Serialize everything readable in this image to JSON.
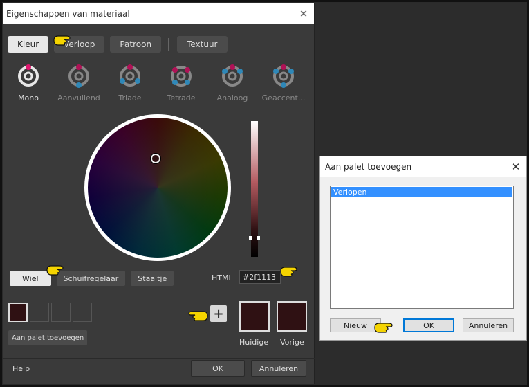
{
  "main_dialog": {
    "title": "Eigenschappen van materiaal",
    "tabs": [
      {
        "label": "Kleur",
        "active": true
      },
      {
        "label": "Verloop",
        "active": false
      },
      {
        "label": "Patroon",
        "active": false
      },
      {
        "label": "Textuur",
        "active": false
      }
    ],
    "schemes": [
      {
        "label": "Mono",
        "active": true
      },
      {
        "label": "Aanvullend",
        "active": false
      },
      {
        "label": "Triade",
        "active": false
      },
      {
        "label": "Tetrade",
        "active": false
      },
      {
        "label": "Analoog",
        "active": false
      },
      {
        "label": "Geaccent...",
        "active": false
      }
    ],
    "view_buttons": [
      {
        "label": "Wiel",
        "active": true
      },
      {
        "label": "Schuifregelaar",
        "active": false
      },
      {
        "label": "Staaltje",
        "active": false
      }
    ],
    "html_label": "HTML",
    "html_value": "#2f1113",
    "add_palette_label": "Aan palet toevoegen",
    "current_label": "Huidige",
    "previous_label": "Vorige",
    "help_label": "Help",
    "ok_label": "OK",
    "cancel_label": "Annuleren",
    "current_color": "#2f1113"
  },
  "sub_dialog": {
    "title": "Aan palet toevoegen",
    "list_items": [
      "Verlopen"
    ],
    "new_label": "Nieuw",
    "ok_label": "OK",
    "cancel_label": "Annuleren"
  },
  "colors": {
    "accent": "#e0166f",
    "secondary": "#3a9fd8",
    "selection": "#3390ff",
    "pointer_hand": "#f5d400"
  }
}
